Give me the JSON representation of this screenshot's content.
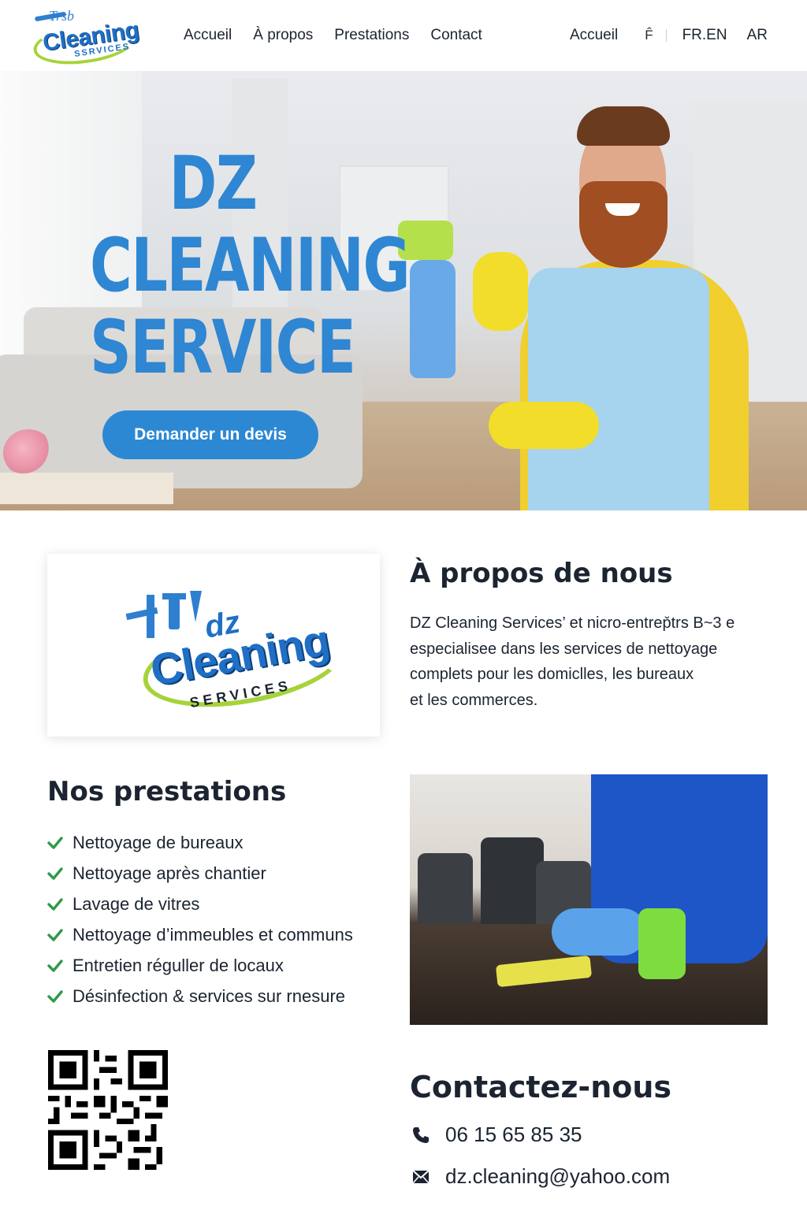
{
  "header": {
    "logo": {
      "top_text": "Trsb",
      "main_text": "Cleaning",
      "sub_text": "SSRVICES"
    },
    "nav": [
      "Accueil",
      "À propos",
      "Prestations",
      "Contact"
    ],
    "nav_right": {
      "home": "Accueil",
      "f": "F̂",
      "lang_fr": "FR",
      "lang_en": ".EN",
      "lang_ar": "AR"
    }
  },
  "hero": {
    "title_lines": [
      "DZ",
      "CLEANING",
      "SERVICE"
    ],
    "cta_label": "Demander un devis"
  },
  "about": {
    "logo": {
      "dz": "dz",
      "main": "Cleaning",
      "sub": "SERVICES"
    },
    "title": "À propos de nous",
    "lines": [
      "DZ Cleaning Services’ et nicro-entrep̆trs B~3  e",
      "especialisee dans les services de nettoyage",
      "complets pour les domiclles, les bureaux",
      "et les commerces."
    ]
  },
  "services": {
    "title": "Nos prestations",
    "items": [
      "Nettoyage de bureaux",
      "Nettoyage après chantier",
      "Lavage de vitres",
      "Nettoyage d’immeubles et communs",
      "Entretien réguller de locaux",
      "Désinfection & services sur rnesure"
    ]
  },
  "contact": {
    "title": "Contactez-nous",
    "phone": "06 15 65 85 35",
    "email": "dz.cleaning@yahoo.com"
  },
  "colors": {
    "accent": "#2d88d3",
    "check": "#2e9a4a",
    "lang_active": "#e23a4a",
    "text": "#1b2430"
  },
  "icons": [
    "spray-bottle-logo-icon",
    "check-icon",
    "phone-icon",
    "email-icon",
    "qr-code"
  ]
}
